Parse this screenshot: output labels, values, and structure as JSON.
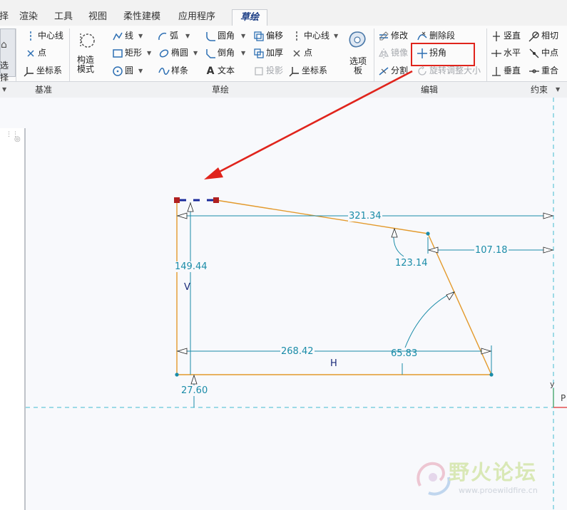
{
  "tabs": [
    "择",
    "渲染",
    "工具",
    "视图",
    "柔性建模",
    "应用程序",
    "草绘"
  ],
  "active_tab": "草绘",
  "select_label": "选择",
  "groups": {
    "datum": "基准",
    "sketch": "草绘",
    "edit": "编辑",
    "constrain": "约束"
  },
  "datum_tools": [
    "中心线",
    "点",
    "坐标系"
  ],
  "construction_mode": "构造\n模式",
  "sketch_tools": {
    "line": "线",
    "arc": "弧",
    "fillet": "圆角",
    "offset": "偏移",
    "centerline": "中心线",
    "rectangle": "矩形",
    "ellipse": "椭圆",
    "chamfer": "倒角",
    "thicken": "加厚",
    "point": "点",
    "circle": "圆",
    "spline": "样条",
    "text": "文本",
    "project": "投影",
    "coord_sys": "坐标系"
  },
  "palette": "选项\n板",
  "edit_tools": {
    "modify": "修改",
    "delete_segment": "删除段",
    "mirror": "镜像",
    "corner": "拐角",
    "divide": "分割",
    "rotate_resize": "旋转调整大小"
  },
  "constrain_tools": {
    "vertical": "竖直",
    "tangent": "相切",
    "horizontal": "水平",
    "midpoint": "中点",
    "perpendicular": "垂直",
    "coincident": "重合"
  },
  "dimensions": {
    "top_width": "321.34",
    "right_offset": "107.18",
    "height": "149.44",
    "angle_top": "123.14",
    "bottom_width": "268.42",
    "angle_bottom": "65.83",
    "bottom_offset": "27.60"
  },
  "constraint_labels": {
    "v": "V",
    "h": "H"
  },
  "axis_labels": {
    "y": "y",
    "p": "P"
  },
  "watermark": {
    "title": "野火论坛",
    "url": "www.proewildfire.cn"
  },
  "colors": {
    "sketch": "#e39a2c",
    "dimension": "#1a8ca8",
    "highlight": "#e0241c",
    "arrow": "#e0241c"
  }
}
